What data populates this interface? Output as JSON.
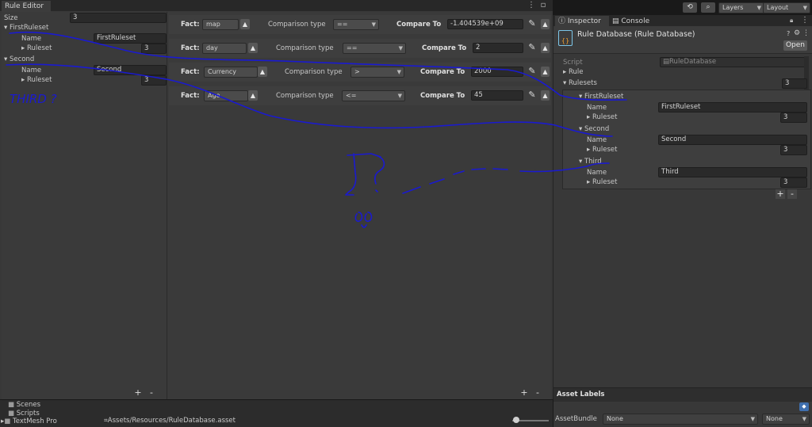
{
  "rule_editor": {
    "tab": "Rule Editor",
    "size_label": "Size",
    "size_value": "3",
    "rulesets": [
      {
        "title": "FirstRuleset",
        "name_label": "Name",
        "name_value": "FirstRuleset",
        "ruleset_label": "Ruleset",
        "ruleset_value": "3"
      },
      {
        "title": "Second",
        "name_label": "Name",
        "name_value": "Second",
        "ruleset_label": "Ruleset",
        "ruleset_value": "3"
      }
    ],
    "rules": [
      {
        "fact_label": "Fact:",
        "fact": "map",
        "comparison_label": "Comparison type",
        "comparison": "==",
        "compare_label": "Compare To",
        "compare_value": "-1.404539e+09"
      },
      {
        "fact_label": "Fact:",
        "fact": "day",
        "comparison_label": "Comparison type",
        "comparison": "==",
        "compare_label": "Compare To",
        "compare_value": "2"
      },
      {
        "fact_label": "Fact:",
        "fact": "Currency",
        "comparison_label": "Comparison type",
        "comparison": ">",
        "compare_label": "Compare To",
        "compare_value": "2000"
      },
      {
        "fact_label": "Fact:",
        "fact": "Age",
        "comparison_label": "Comparison type",
        "comparison": "<=",
        "compare_label": "Compare To",
        "compare_value": "45"
      }
    ],
    "plus": "+",
    "minus": "-"
  },
  "annotations": {
    "third_note": "THIRD ?"
  },
  "project": {
    "folders": [
      "Scenes",
      "Scripts",
      "TextMesh Pro"
    ],
    "path": "Assets/Resources/RuleDatabase.asset"
  },
  "inspector": {
    "tabs": [
      "Inspector",
      "Console"
    ],
    "title": "Rule Database (Rule Database)",
    "open_label": "Open",
    "script_label": "Script",
    "script_value": "RuleDatabase",
    "rule_label": "Rule",
    "rulesets_label": "Rulesets",
    "rulesets_size": "3",
    "items": [
      {
        "title": "FirstRuleset",
        "name_label": "Name",
        "name_value": "FirstRuleset",
        "ruleset_label": "Ruleset",
        "ruleset_value": "3"
      },
      {
        "title": "Second",
        "name_label": "Name",
        "name_value": "Second",
        "ruleset_label": "Ruleset",
        "ruleset_value": "3"
      },
      {
        "title": "Third",
        "name_label": "Name",
        "name_value": "Third",
        "ruleset_label": "Ruleset",
        "ruleset_value": "3"
      }
    ],
    "asset_labels": "Asset Labels",
    "assetbundle_label": "AssetBundle",
    "assetbundle_value": "None",
    "variant_value": "None"
  },
  "toolbar": {
    "layers_label": "Layers",
    "layout_label": "Layout"
  },
  "colors": {
    "panel": "#383838",
    "accent_ink": "#1a1ad0"
  }
}
